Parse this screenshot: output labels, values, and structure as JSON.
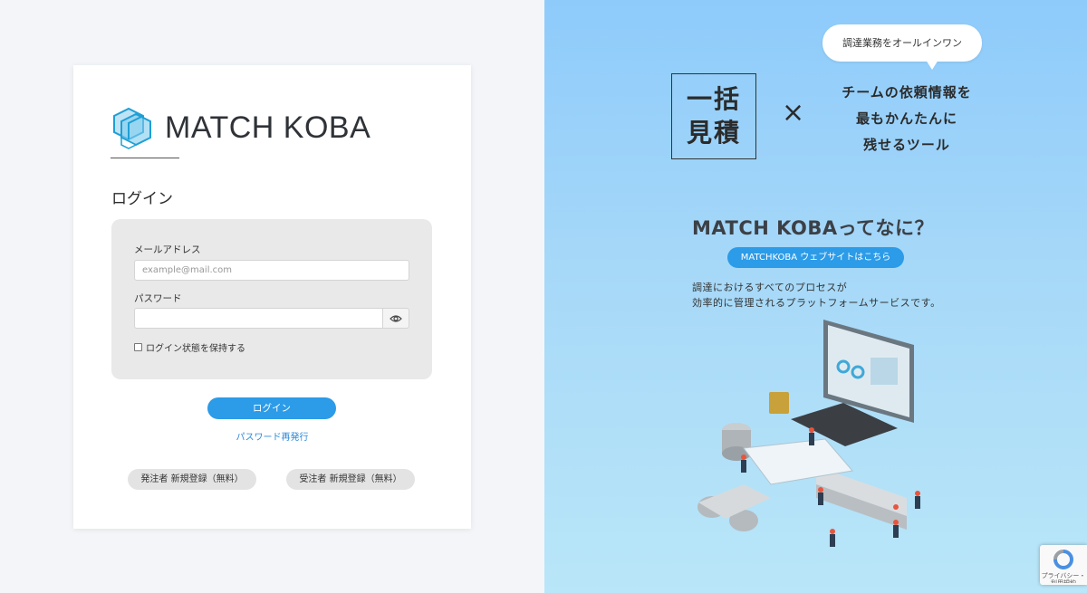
{
  "login": {
    "logo_text": "MATCH KOBA",
    "title": "ログイン",
    "email_label": "メールアドレス",
    "email_placeholder": "example@mail.com",
    "password_label": "パスワード",
    "remember_label": "ログイン状態を保持する",
    "login_button": "ログイン",
    "reissue_link": "パスワード再発行",
    "register_client_button": "発注者 新規登録（無料）",
    "register_supplier_button": "受注者 新規登録（無料）"
  },
  "promo": {
    "bubble": "調達業務をオールインワン",
    "ikkatsu_line1": "一括",
    "ikkatsu_line2": "見積",
    "times": "×",
    "tagline_line1": "チームの依頼情報を",
    "tagline_line2": "最もかんたんに",
    "tagline_line3": "残せるツール",
    "whatis": "MATCH KOBAってなに？",
    "site_button": "MATCHKOBA ウェブサイトはこちら",
    "desc_line1": "調達におけるすべてのプロセスが",
    "desc_line2": "効率的に管理されるプラットフォームサービスです。"
  },
  "recaptcha": {
    "text": "プライバシー・利用規約"
  },
  "colors": {
    "accent": "#2c9be8",
    "panel_bg": "#8ecbfb"
  }
}
